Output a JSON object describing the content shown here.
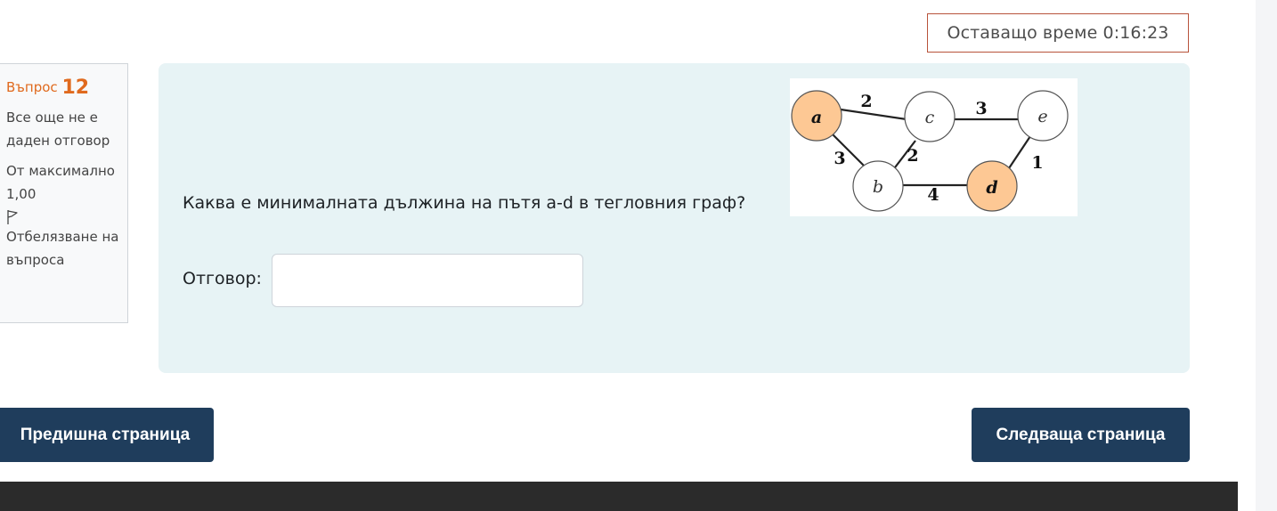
{
  "timer": {
    "text": "Оставащо време 0:16:23"
  },
  "question_info": {
    "label": "Въпрос",
    "number": "12",
    "state": "Все още не е даден отговор",
    "grade": "От максимално 1,00",
    "flag_label": "Отбелязване на въпроса"
  },
  "question": {
    "text": "Каква е минималната дължина на пътя a-d в тегловния граф?",
    "answer_label": "Отговор:",
    "answer_value": "",
    "graph": {
      "nodes": [
        {
          "id": "a",
          "label": "a",
          "highlighted": true
        },
        {
          "id": "c",
          "label": "c",
          "highlighted": false
        },
        {
          "id": "e",
          "label": "e",
          "highlighted": false
        },
        {
          "id": "b",
          "label": "b",
          "highlighted": false
        },
        {
          "id": "d",
          "label": "d",
          "highlighted": true
        }
      ],
      "edges": [
        {
          "from": "a",
          "to": "c",
          "weight": "2"
        },
        {
          "from": "c",
          "to": "e",
          "weight": "3"
        },
        {
          "from": "a",
          "to": "b",
          "weight": "3"
        },
        {
          "from": "c",
          "to": "b",
          "weight": "2"
        },
        {
          "from": "e",
          "to": "d",
          "weight": "1"
        },
        {
          "from": "b",
          "to": "d",
          "weight": "4"
        }
      ],
      "highlight_color": "#fdc894"
    }
  },
  "navigation": {
    "prev_label": "Предишна страница",
    "next_label": "Следваща страница"
  }
}
